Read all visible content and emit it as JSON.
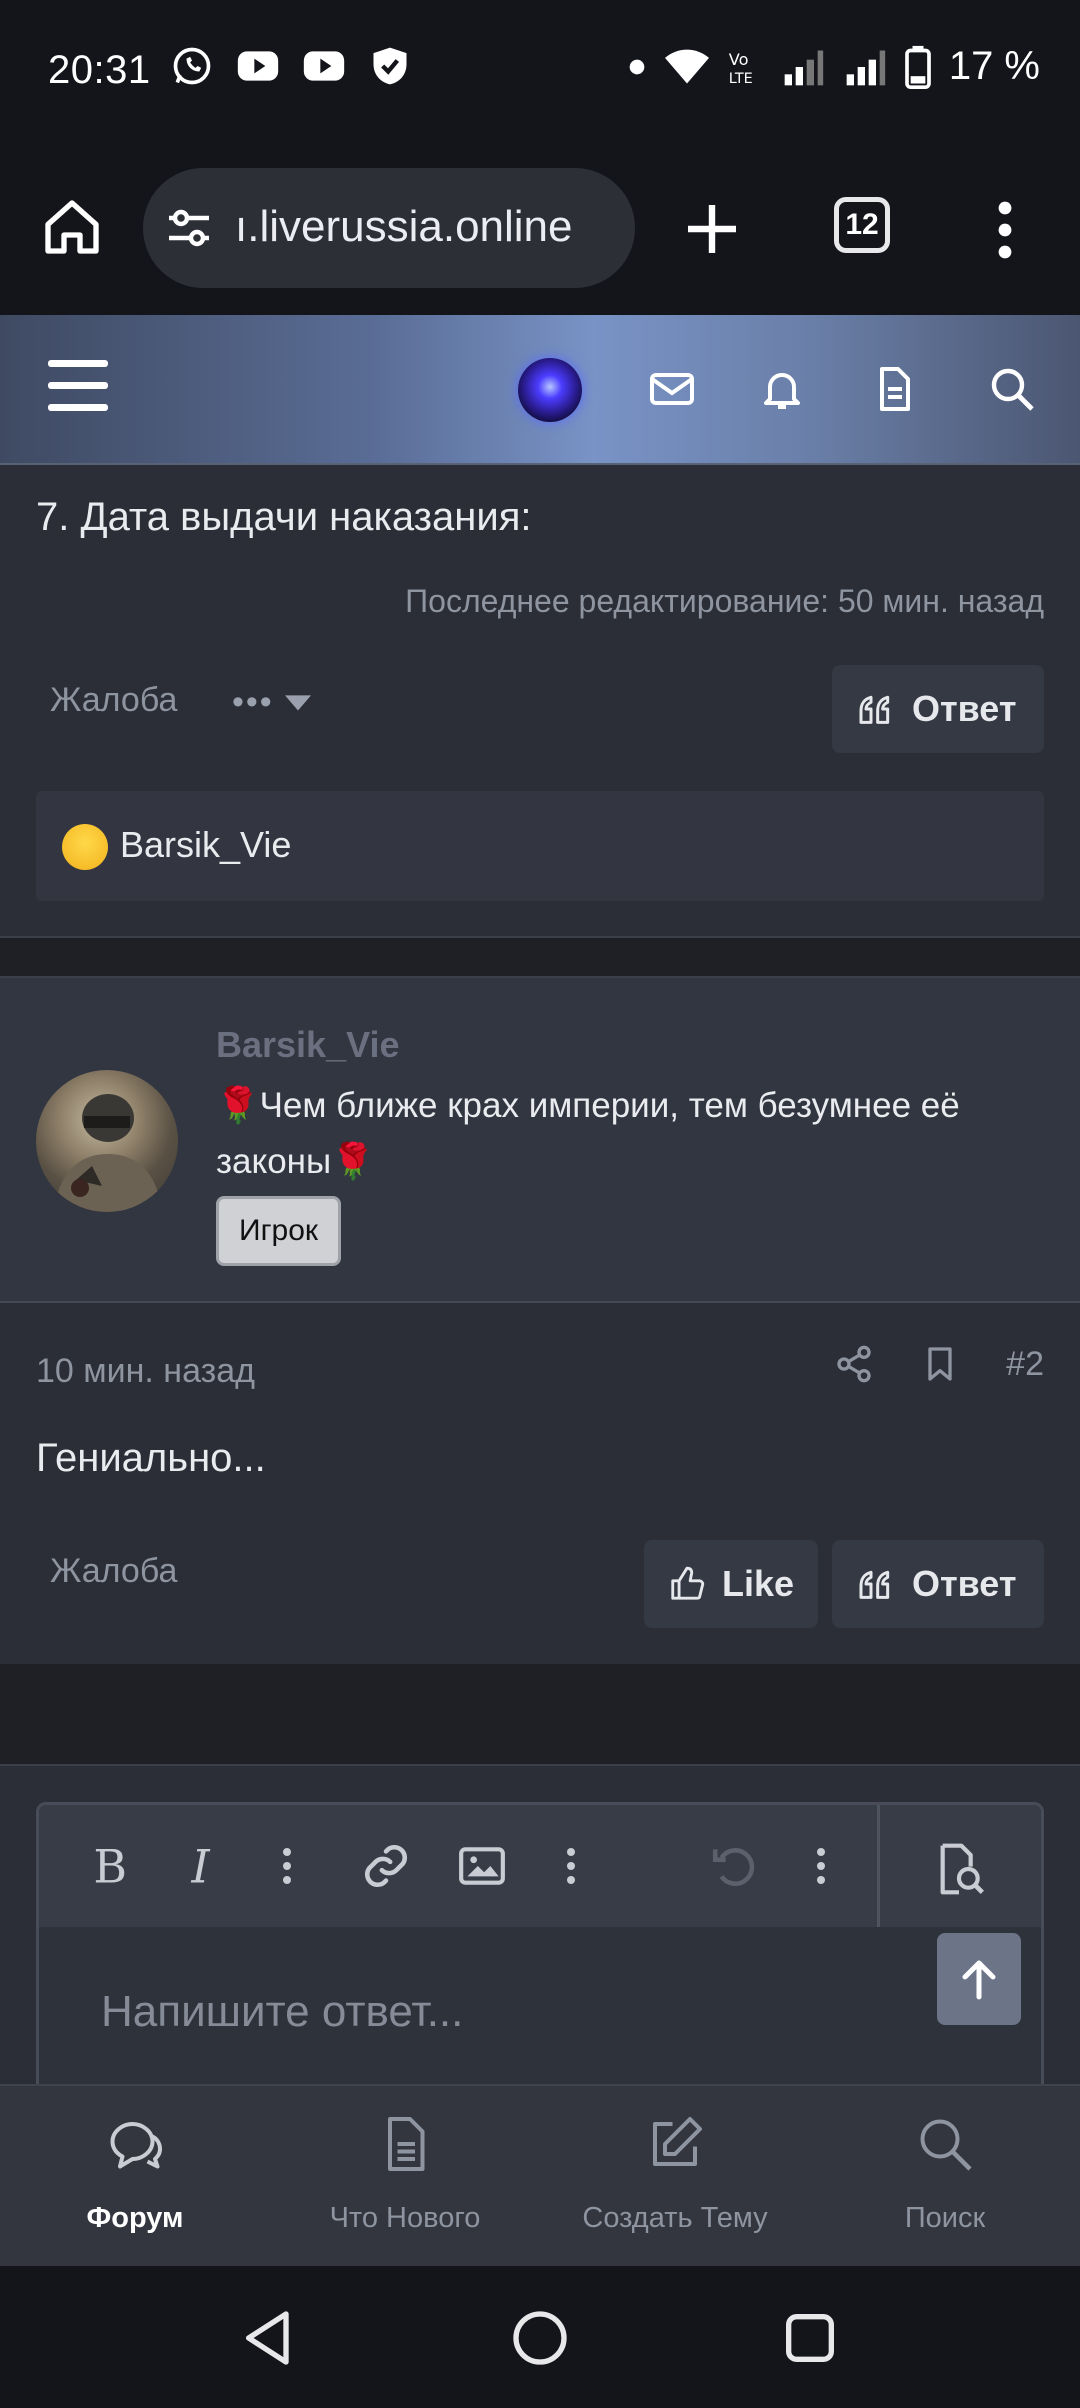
{
  "status_bar": {
    "time": "20:31",
    "battery": "17 %",
    "left_icons": [
      "whatsapp-icon",
      "youtube-icon",
      "youtube-icon",
      "shield-icon"
    ],
    "right_icons": [
      "dot-icon",
      "wifi-icon",
      "volte-icon",
      "signal-icon",
      "signal-icon",
      "battery-icon"
    ]
  },
  "browser": {
    "url": "ı.liverussia.online",
    "tab_count": "12"
  },
  "post1": {
    "text": "7. Дата выдачи наказания:",
    "edited": "Последнее редактирование: 50 мин. назад",
    "report_label": "Жалоба",
    "more_label": "•••",
    "reply_label": "Ответ",
    "liked_by": "Barsik_Vie"
  },
  "post2": {
    "username": "Barsik_Vie",
    "user_title": "Чем ближе крах империи, тем безумнее её законы",
    "role": "Игрок",
    "time": "10 мин. назад",
    "post_number": "#2",
    "body": "Гениально...",
    "report_label": "Жалоба",
    "like_label": "Like",
    "reply_label": "Ответ"
  },
  "editor": {
    "placeholder": "Напишите ответ..."
  },
  "bottom_nav": {
    "items": [
      {
        "label": "Форум",
        "icon": "chat-icon",
        "active": true
      },
      {
        "label": "Что Нового",
        "icon": "document-icon",
        "active": false
      },
      {
        "label": "Создать Тему",
        "icon": "edit-icon",
        "active": false
      },
      {
        "label": "Поиск",
        "icon": "search-icon",
        "active": false
      }
    ]
  },
  "colors": {
    "page_bg": "#23252b",
    "panel_bg": "#2b2e36",
    "accent_header": "#7993c6",
    "muted_text": "#8e94a0",
    "rose": "#d3232f"
  }
}
